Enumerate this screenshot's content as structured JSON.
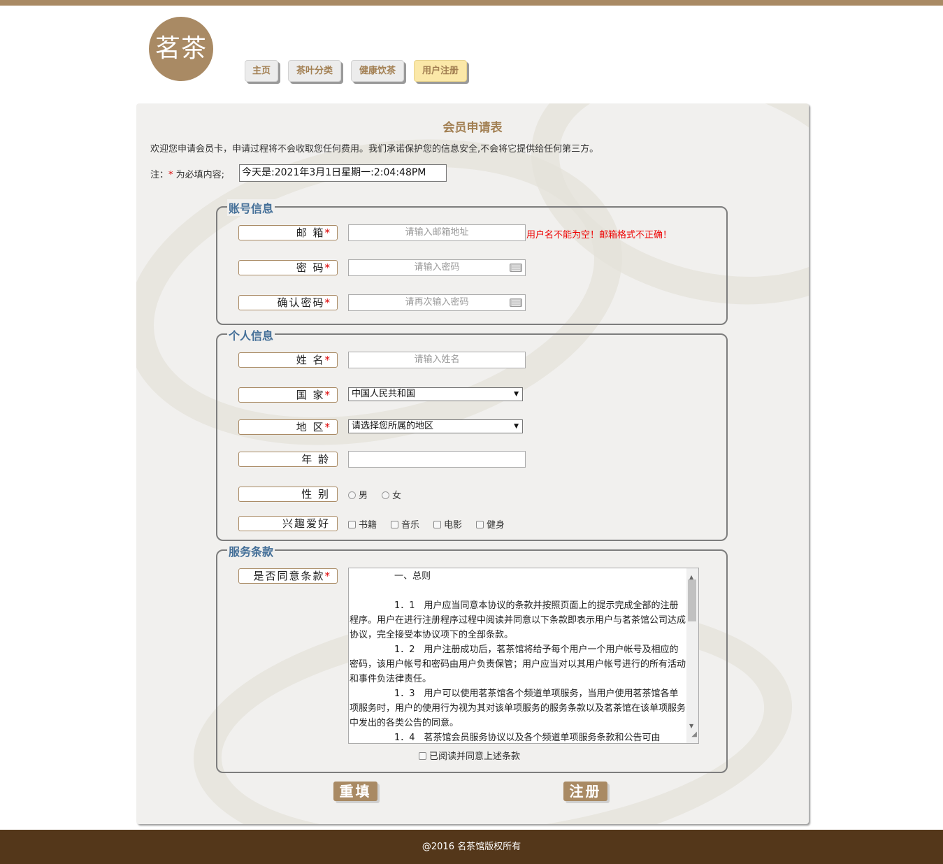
{
  "brand": {
    "logo_text": "茗茶",
    "primary_color": "#a98a64",
    "footer_color": "#54371a"
  },
  "nav": {
    "items": [
      {
        "label": "主页",
        "active": false
      },
      {
        "label": "茶叶分类",
        "active": false
      },
      {
        "label": "健康饮茶",
        "active": false
      },
      {
        "label": "用户注册",
        "active": true
      }
    ]
  },
  "form": {
    "title": "会员申请表",
    "welcome": "欢迎您申请会员卡，申请过程将不会收取您任何费用。我们承诺保护您的信息安全,不会将它提供给任何第三方。",
    "note_prefix": "注：",
    "note_star": "*",
    "note_suffix": " 为必填内容;",
    "date_value": "今天是:2021年3月1日星期一:2:04:48PM"
  },
  "account": {
    "legend": "账号信息",
    "email_label": "邮  箱",
    "email_placeholder": "请输入邮箱地址",
    "email_error": "用户名不能为空！邮箱格式不正确！",
    "password_label": "密  码",
    "password_placeholder": "请输入密码",
    "confirm_label": "确认密码",
    "confirm_placeholder": "请再次输入密码",
    "keyboard_icon": "keyboard-icon"
  },
  "personal": {
    "legend": "个人信息",
    "name_label": "姓  名",
    "name_placeholder": "请输入姓名",
    "country_label": "国  家",
    "country_value": "中国人民共和国",
    "region_label": "地  区",
    "region_value": "请选择您所属的地区",
    "age_label": "年  龄",
    "gender_label": "性  别",
    "gender_options": [
      "男",
      "女"
    ],
    "hobby_label": "兴趣爱好",
    "hobby_options": [
      "书籍",
      "音乐",
      "电影",
      "健身"
    ]
  },
  "terms": {
    "legend": "服务条款",
    "agree_label": "是否同意条款",
    "heading": "一、总则",
    "clauses": [
      "1．1　用户应当同意本协议的条款并按照页面上的提示完成全部的注册程序。用户在进行注册程序过程中阅读并同意以下条款即表示用户与茗茶馆公司达成协议，完全接受本协议项下的全部条款。",
      "1．2　用户注册成功后，茗茶馆将给予每个用户一个用户帐号及相应的密码，该用户帐号和密码由用户负责保管；用户应当对以其用户帐号进行的所有活动和事件负法律责任。",
      "1．3　用户可以使用茗茶馆各个频道单项服务，当用户使用茗茶馆各单项服务时，用户的使用行为视为其对该单项服务的服务条款以及茗茶馆在该单项服务中发出的各类公告的同意。",
      "1．4　茗茶馆会员服务协议以及各个频道单项服务条款和公告可由"
    ],
    "read_agree": "已阅读并同意上述条款"
  },
  "actions": {
    "reset_label": "重填",
    "submit_label": "注册"
  },
  "footer": {
    "text": "@2016 名茶馆版权所有"
  }
}
